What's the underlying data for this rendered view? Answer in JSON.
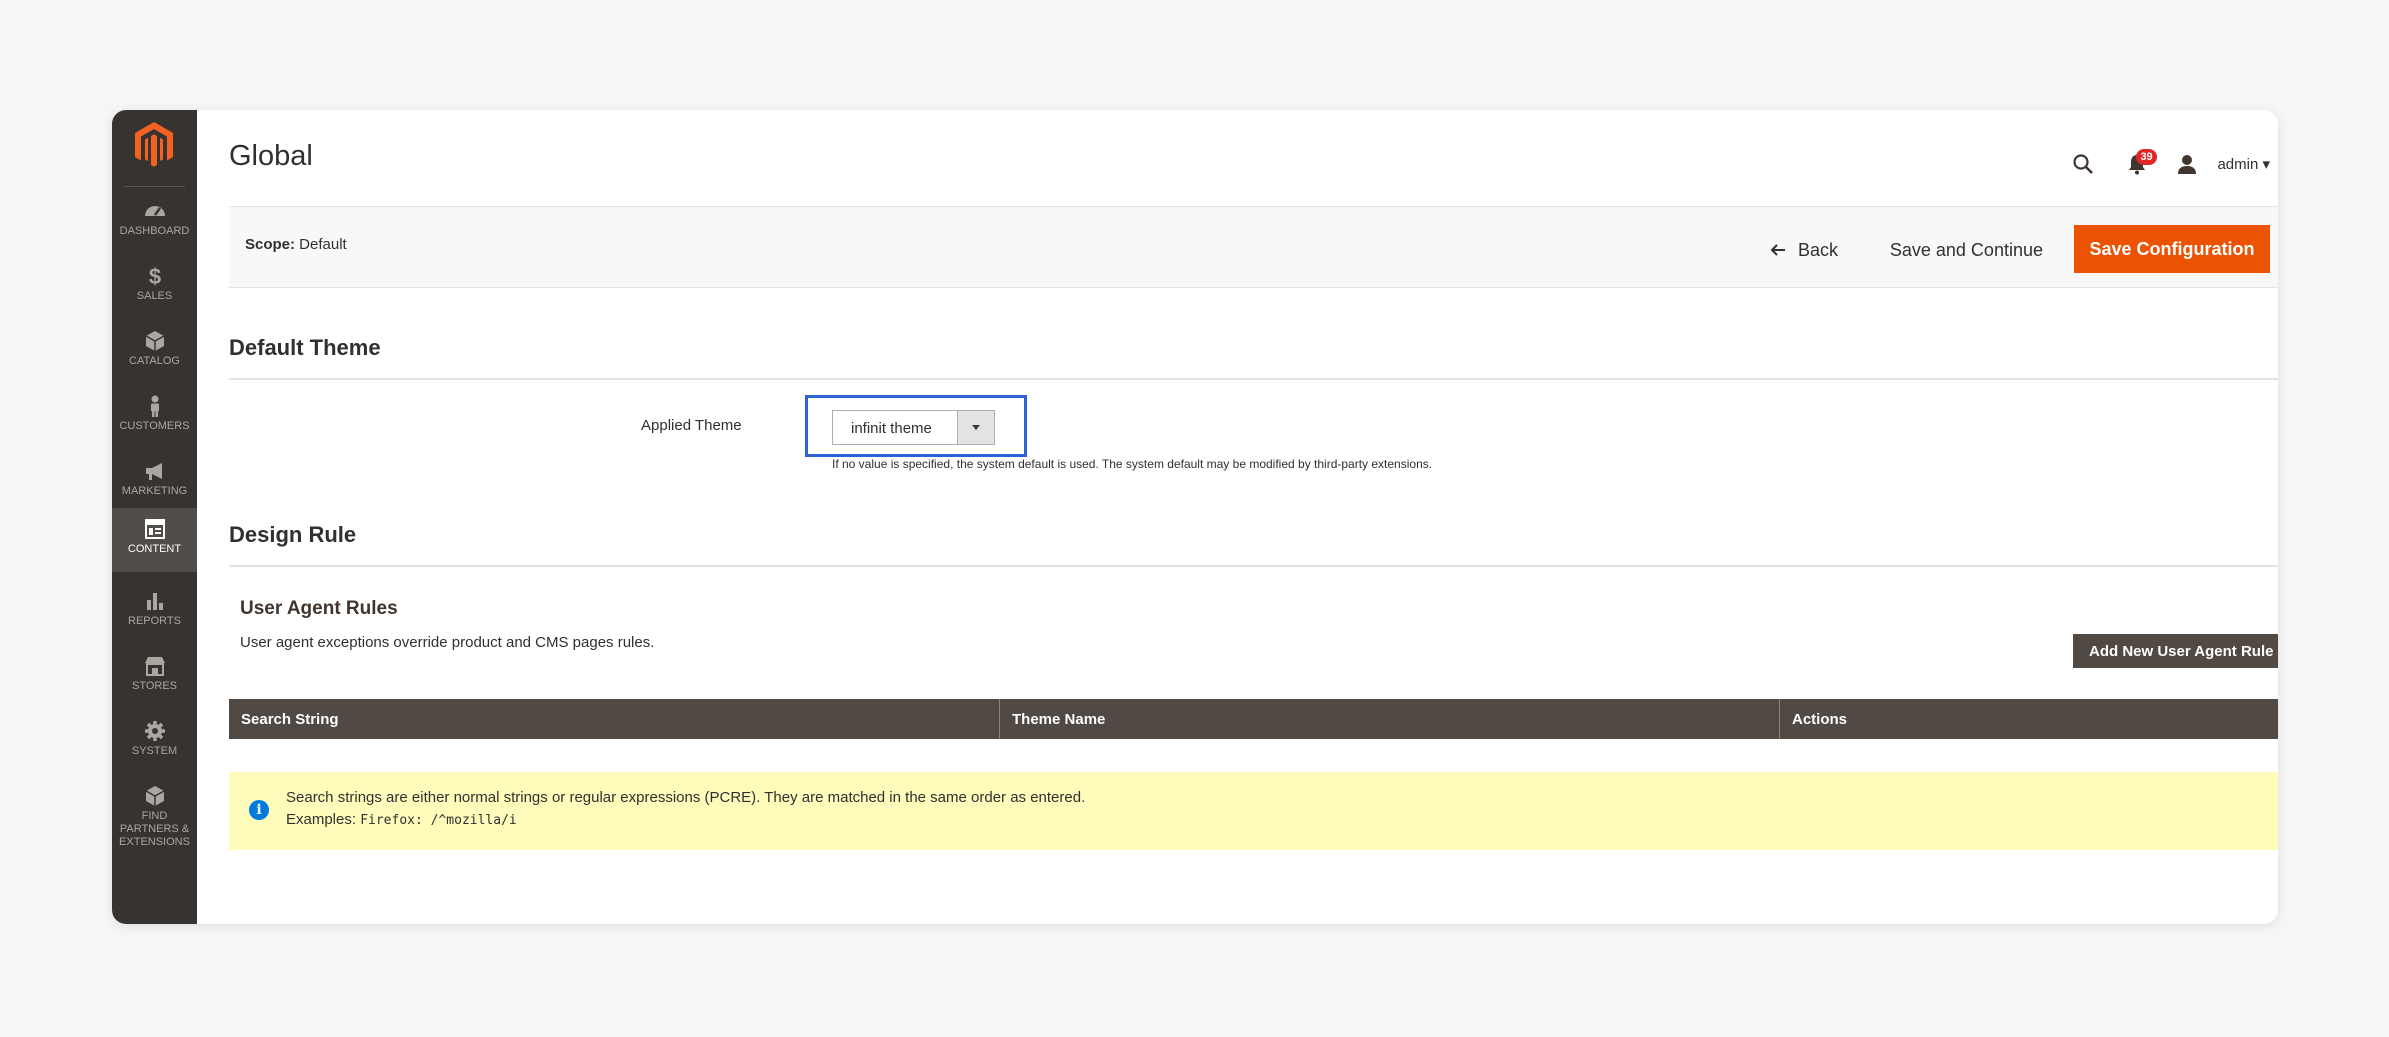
{
  "sidebar": {
    "items": [
      {
        "label": "DASHBOARD",
        "icon": "dashboard-icon"
      },
      {
        "label": "SALES",
        "icon": "dollar-icon"
      },
      {
        "label": "CATALOG",
        "icon": "box-icon"
      },
      {
        "label": "CUSTOMERS",
        "icon": "person-icon"
      },
      {
        "label": "MARKETING",
        "icon": "megaphone-icon"
      },
      {
        "label": "CONTENT",
        "icon": "layout-icon",
        "active": true
      },
      {
        "label": "REPORTS",
        "icon": "bar-chart-icon"
      },
      {
        "label": "STORES",
        "icon": "store-icon"
      },
      {
        "label": "SYSTEM",
        "icon": "gear-icon"
      },
      {
        "label": "FIND PARTNERS & EXTENSIONS",
        "icon": "cube-icon"
      }
    ]
  },
  "header": {
    "title": "Global",
    "notification_count": "39",
    "user_label": "admin ▾"
  },
  "page_actions": {
    "scope_label": "Scope:",
    "scope_value": " Default",
    "back_label": "Back",
    "save_continue_label": "Save and Continue",
    "save_config_label": "Save Configuration"
  },
  "default_theme": {
    "section_title": "Default Theme",
    "field_label": "Applied Theme",
    "selected_value": "infinit theme",
    "note": "If no value is specified, the system default is used. The system default may be modified by third-party extensions."
  },
  "design_rule": {
    "section_title": "Design Rule",
    "subsection_title": "User Agent Rules",
    "description": "User agent exceptions override product and CMS pages rules.",
    "add_button_label": "Add New User Agent Rule",
    "columns": [
      "Search String",
      "Theme Name",
      "Actions"
    ]
  },
  "message": {
    "line1": "Search strings are either normal strings or regular expressions (PCRE). They are matched in the same order as entered.",
    "examples_label": "Examples: ",
    "example_code": "Firefox: /^mozilla/i"
  },
  "colors": {
    "sidebar_bg": "#373330",
    "accent": "#eb5202",
    "highlight": "#2f62d7",
    "grid_header": "#514943",
    "message_bg": "#fffbbb"
  }
}
